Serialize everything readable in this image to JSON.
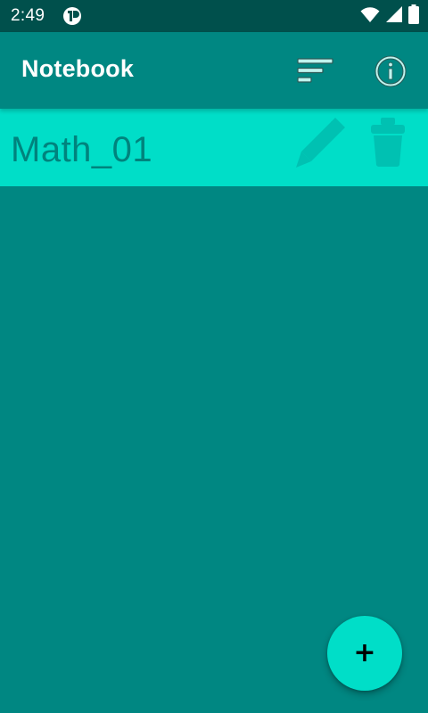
{
  "status_bar": {
    "time": "2:49",
    "icons": [
      "app-notification-icon",
      "wifi-icon",
      "signal-icon",
      "battery-icon"
    ]
  },
  "app_bar": {
    "title": "Notebook",
    "actions": [
      "sort-icon",
      "info-icon"
    ]
  },
  "notebooks": [
    {
      "name": "Math_01",
      "actions": [
        "pencil-icon",
        "trash-icon"
      ]
    }
  ],
  "fab": {
    "icon": "+"
  },
  "colors": {
    "status_bar": "#00504c",
    "background": "#008782",
    "row_highlight": "#00dec8",
    "row_text": "#00837d",
    "fab": "#00dec8"
  }
}
